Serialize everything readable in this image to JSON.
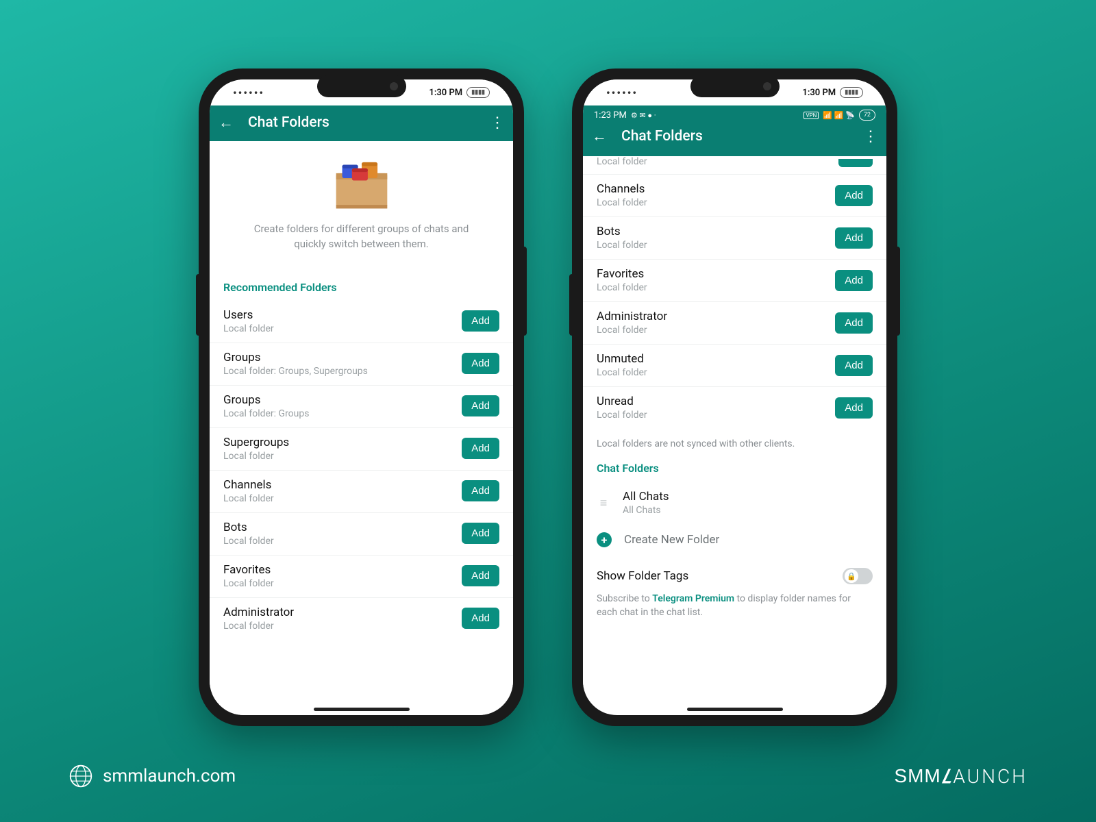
{
  "mock_status": {
    "dots": "••••••",
    "time": "1:30 PM",
    "battery": "█████"
  },
  "phone1": {
    "title": "Chat Folders",
    "intro": "Create folders for different groups of chats and quickly switch between them.",
    "section": "Recommended Folders",
    "add_label": "Add",
    "rows": [
      {
        "title": "Users",
        "sub": "Local folder"
      },
      {
        "title": "Groups",
        "sub": "Local folder: Groups, Supergroups"
      },
      {
        "title": "Groups",
        "sub": "Local folder: Groups"
      },
      {
        "title": "Supergroups",
        "sub": "Local folder"
      },
      {
        "title": "Channels",
        "sub": "Local folder"
      },
      {
        "title": "Bots",
        "sub": "Local folder"
      },
      {
        "title": "Favorites",
        "sub": "Local folder"
      },
      {
        "title": "Administrator",
        "sub": "Local folder"
      }
    ]
  },
  "phone2": {
    "inner_time": "1:23 PM",
    "vpn": "VPN",
    "batt_pct": "72",
    "title": "Chat Folders",
    "partial_sub": "Local folder",
    "add_label": "Add",
    "rows": [
      {
        "title": "Channels",
        "sub": "Local folder"
      },
      {
        "title": "Bots",
        "sub": "Local folder"
      },
      {
        "title": "Favorites",
        "sub": "Local folder"
      },
      {
        "title": "Administrator",
        "sub": "Local folder"
      },
      {
        "title": "Unmuted",
        "sub": "Local folder"
      },
      {
        "title": "Unread",
        "sub": "Local folder"
      }
    ],
    "hint": "Local folders are not synced with other clients.",
    "cf_section": "Chat Folders",
    "all_chats": "All Chats",
    "all_chats_sub": "All Chats",
    "create_new": "Create New Folder",
    "toggle_label": "Show Folder Tags",
    "premium_pre": "Subscribe to ",
    "premium_link": "Telegram Premium",
    "premium_post": " to display folder names for each chat in the chat list."
  },
  "footer": {
    "url": "smmlaunch.com",
    "brand_a": "SMM",
    "brand_b": "AUNCH"
  }
}
